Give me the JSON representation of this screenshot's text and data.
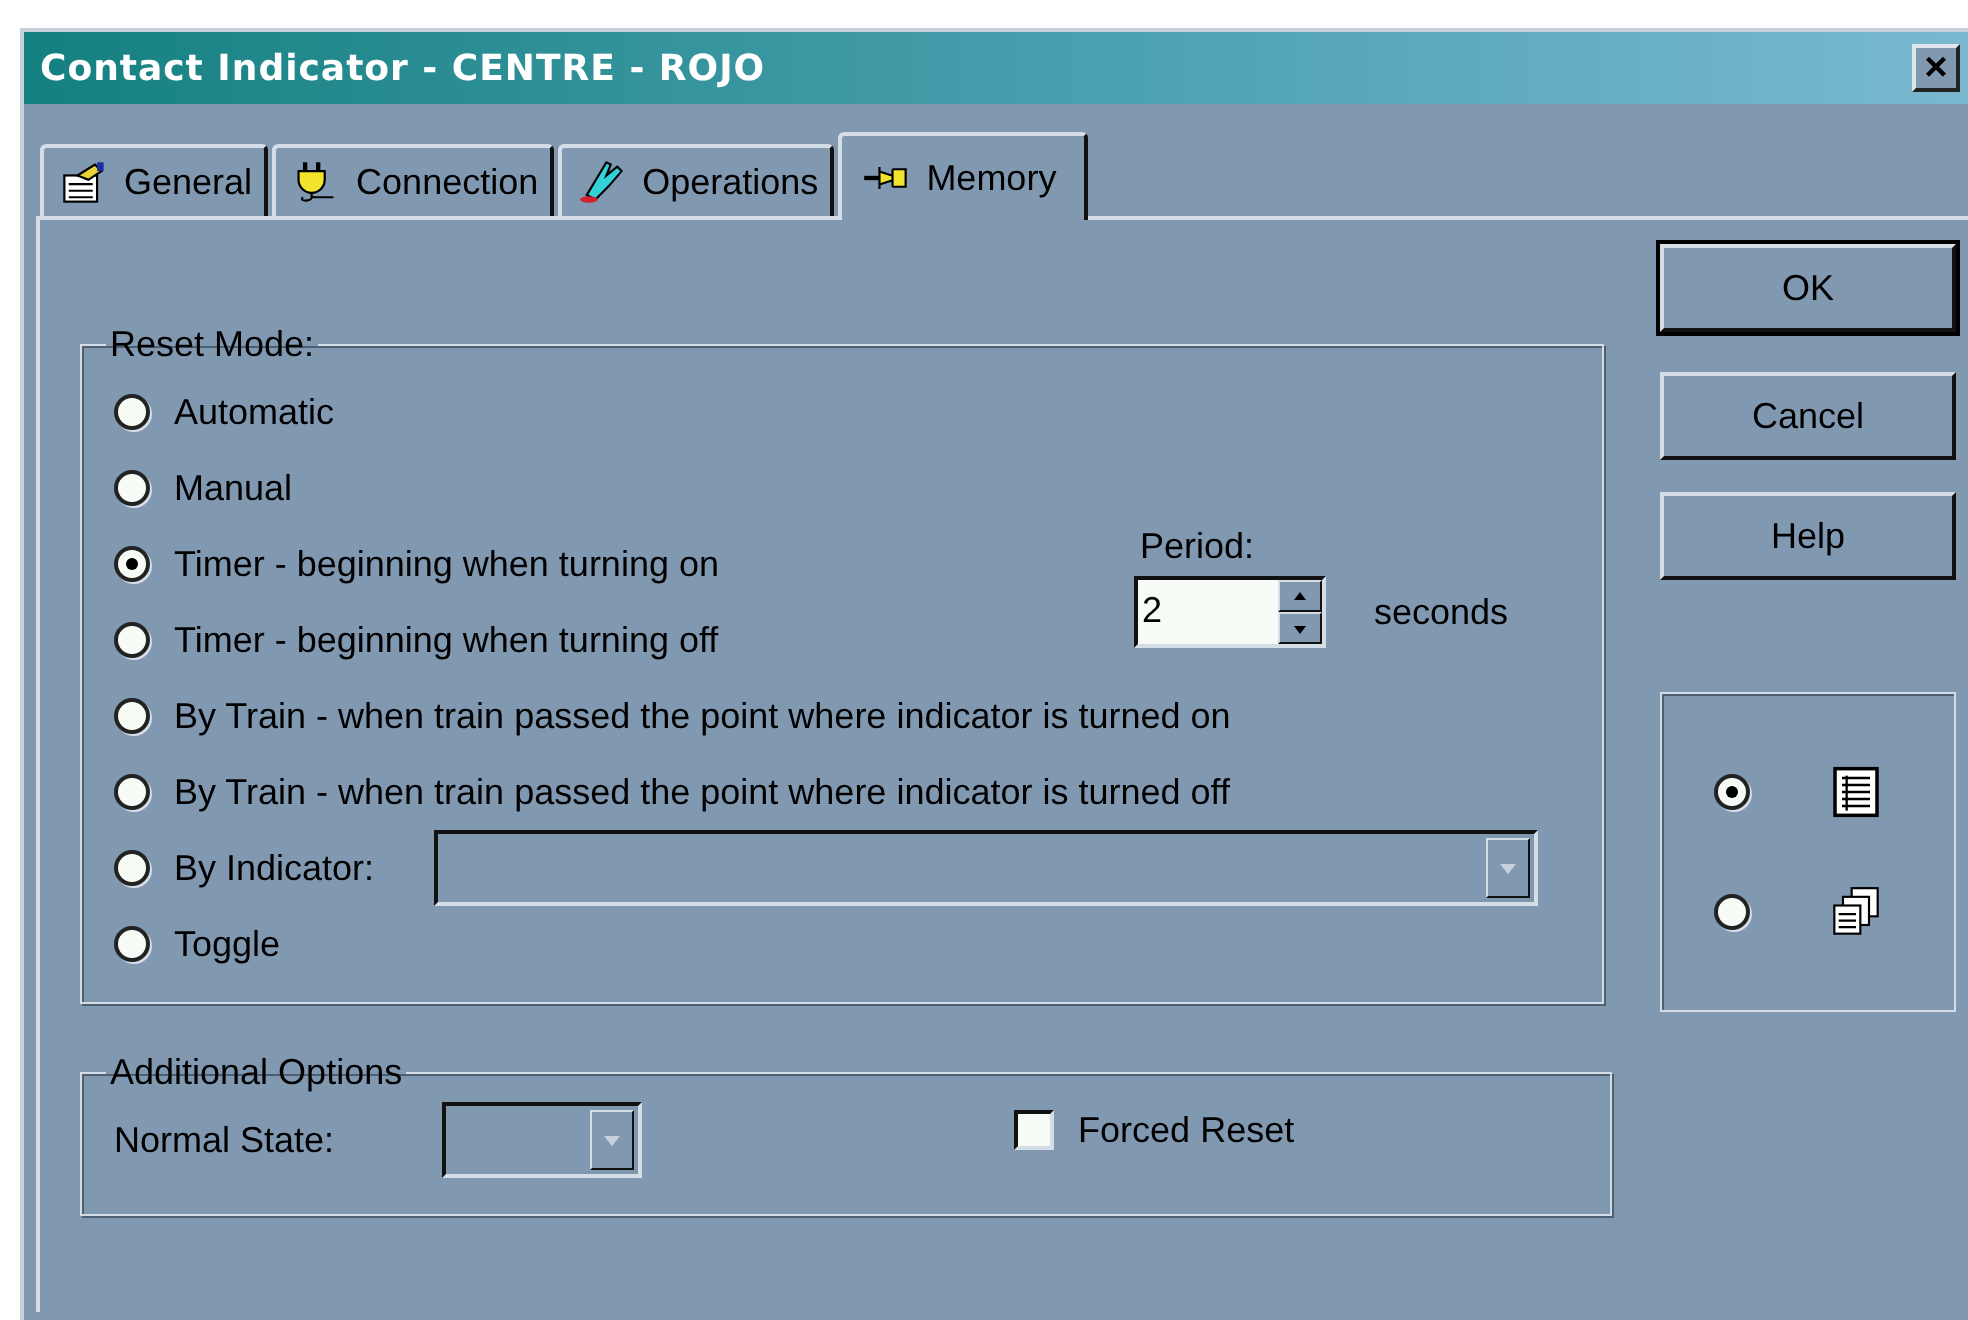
{
  "window": {
    "title": "Contact Indicator - CENTRE - ROJO",
    "close": "×"
  },
  "tabs": [
    {
      "label": "General",
      "kind": "general",
      "selected": false
    },
    {
      "label": "Connection",
      "kind": "connection",
      "selected": false
    },
    {
      "label": "Operations",
      "kind": "operations",
      "selected": false
    },
    {
      "label": "Memory",
      "kind": "memory",
      "selected": true
    }
  ],
  "reset_mode": {
    "title": "Reset Mode:",
    "options": [
      {
        "label": "Automatic",
        "selected": false
      },
      {
        "label": "Manual",
        "selected": false
      },
      {
        "label": "Timer - beginning when turning on",
        "selected": true
      },
      {
        "label": "Timer - beginning when turning off",
        "selected": false
      },
      {
        "label": "By Train - when train passed the point where indicator is turned on",
        "selected": false
      },
      {
        "label": "By Train - when train passed the point where indicator is turned off",
        "selected": false
      },
      {
        "label": "By Indicator:",
        "selected": false
      },
      {
        "label": "Toggle",
        "selected": false
      }
    ],
    "period": {
      "label": "Period:",
      "value": "2",
      "unit": "seconds"
    }
  },
  "additional_options": {
    "title": "Additional Options",
    "normal_state_label": "Normal State:",
    "forced_reset": {
      "label": "Forced Reset",
      "checked": false
    }
  },
  "buttons": [
    {
      "label": "OK",
      "default": true
    },
    {
      "label": "Cancel",
      "default": false
    },
    {
      "label": "Help",
      "default": false
    }
  ],
  "view_options": [
    {
      "kind": "list",
      "selected": true
    },
    {
      "kind": "cascade",
      "selected": false
    }
  ]
}
